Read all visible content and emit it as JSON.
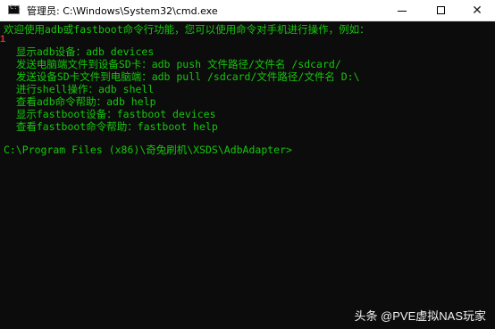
{
  "window": {
    "title": "管理员: C:\\Windows\\System32\\cmd.exe",
    "buttons": {
      "minimize": "—",
      "maximize": "□",
      "close": "✕"
    },
    "icon": "cmd-icon"
  },
  "console": {
    "lines": [
      "欢迎使用adb或fastboot命令行功能，您可以使用命令对手机进行操作，例如：",
      "",
      "  显示adb设备：adb devices",
      "  发送电脑端文件到设备SD卡：adb push 文件路径/文件名 /sdcard/",
      "  发送设备SD卡文件到电脑端：adb pull /sdcard/文件路径/文件名 D:\\",
      "  进行shell操作：adb shell",
      "  查看adb命令帮助：adb help",
      "  显示fastboot设备：fastboot devices",
      "  查看fastboot命令帮助：fastboot help",
      "",
      "C:\\Program Files (x86)\\奇兔刷机\\XSDS\\AdbAdapter>"
    ]
  },
  "marker": "1",
  "watermark": "头条 @PVE虚拟NAS玩家",
  "colors": {
    "console_bg": "#0c0c0c",
    "console_text": "#16c60c",
    "titlebar_bg": "#ffffff"
  }
}
